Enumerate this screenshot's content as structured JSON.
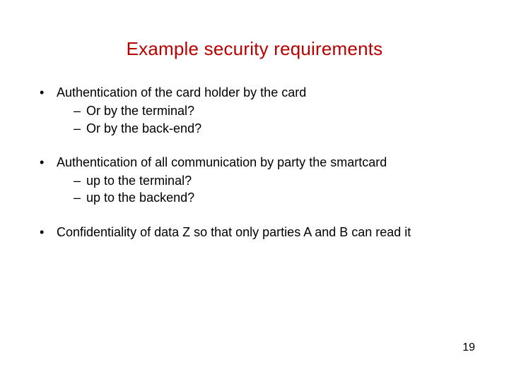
{
  "title": "Example security requirements",
  "bullets": [
    {
      "text": "Authentication of the card holder by the card",
      "sub": [
        "Or by the terminal?",
        "Or by the back-end?"
      ]
    },
    {
      "text": "Authentication of all communication by party the smartcard",
      "sub": [
        "up to the terminal?",
        "up to the backend?"
      ]
    },
    {
      "text": "Confidentiality of data Z so that only parties A and B can read it",
      "sub": []
    }
  ],
  "page_number": "19"
}
